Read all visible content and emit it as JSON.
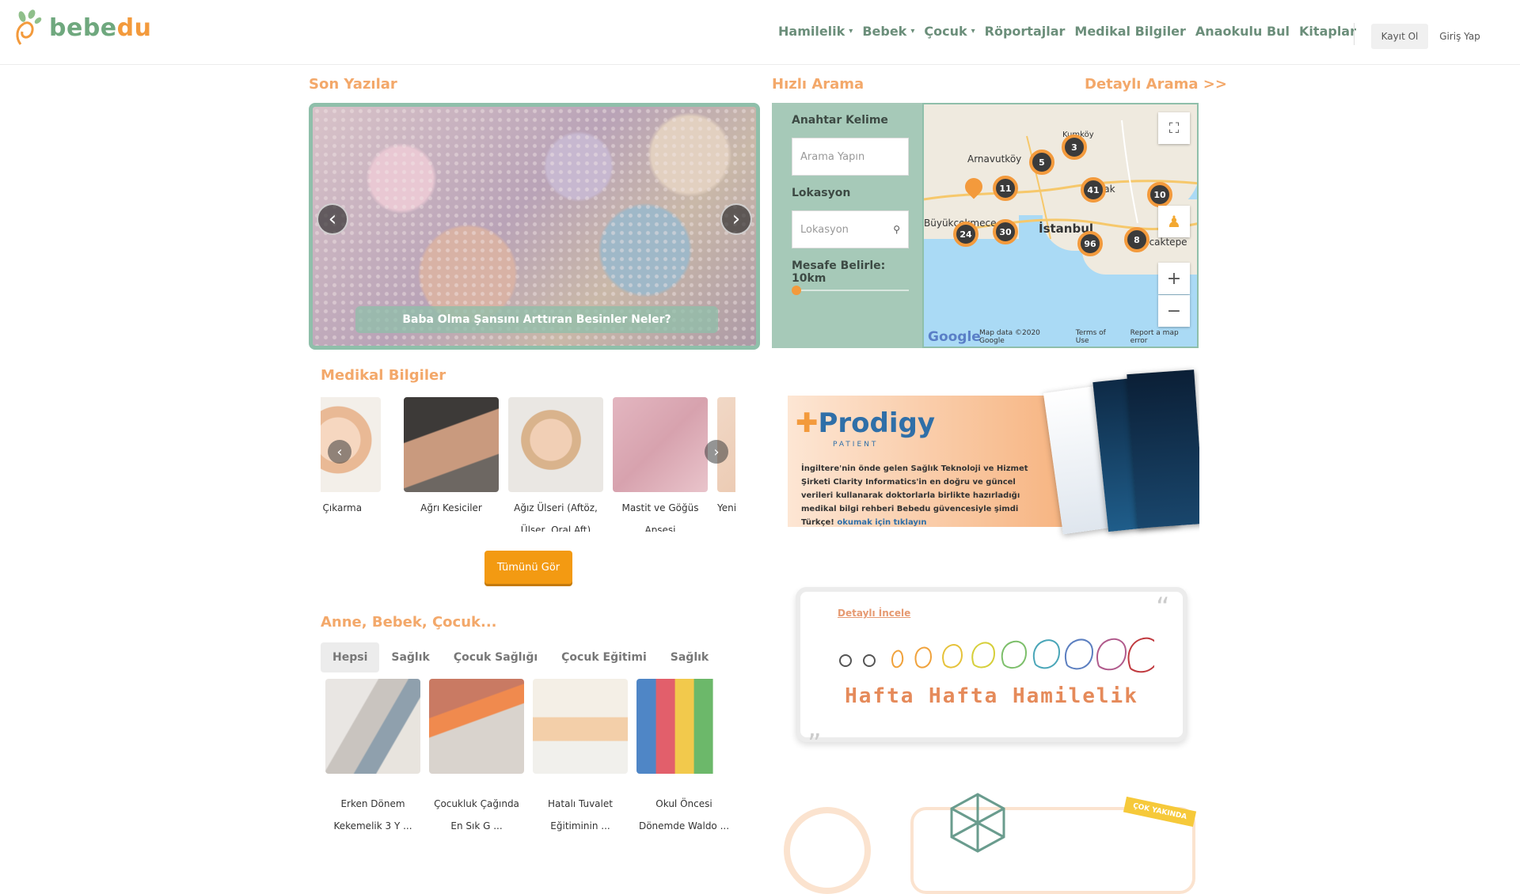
{
  "header": {
    "logo_text_a": "bebe",
    "logo_text_b": "du",
    "nav": [
      "Hamilelik",
      "Bebek",
      "Çocuk",
      "Röportajlar",
      "Medikal Bilgiler",
      "Anaokulu Bul",
      "Kitaplar"
    ],
    "register": "Kayıt Ol",
    "login": "Giriş Yap"
  },
  "latest": {
    "title": "Son Yazılar",
    "caption": "Baba Olma Şansını Arttıran Besinler Neler?"
  },
  "quick_search": {
    "title": "Hızlı Arama",
    "detailed_link": "Detaylı Arama >>",
    "keyword_label": "Anahtar Kelime",
    "keyword_placeholder": "Arama Yapın",
    "location_label": "Lokasyon",
    "location_placeholder": "Lokasyon",
    "distance_label": "Mesafe Belirle: 10km"
  },
  "map": {
    "places": [
      "Kumköy",
      "Arnavutköy",
      "Maslak",
      "Büyükçekmece",
      "İstanbul",
      "Sancaktepe"
    ],
    "clusters": [
      "3",
      "5",
      "11",
      "41",
      "10",
      "24",
      "30",
      "96",
      "8"
    ],
    "google": "Google",
    "map_data": "Map data ©2020 Google",
    "terms": "Terms of Use",
    "report": "Report a map error"
  },
  "medical": {
    "title": "Medikal Bilgiler",
    "items": [
      "Diş Çıkarma",
      "Ağrı Kesiciler",
      "Ağız Ülseri (Aftöz, Ülser, Oral Aft)",
      "Mastit ve Göğüs Apsesi",
      "Yeni"
    ],
    "all_button": "Tümünü Gör"
  },
  "articles": {
    "title": "Anne, Bebek, Çocuk...",
    "tabs": [
      "Hepsi",
      "Sağlık",
      "Çocuk Sağlığı",
      "Çocuk Eğitimi",
      "Sağlık"
    ],
    "items": [
      "Erken Dönem Kekemelik 3 Y ...",
      "Çocukluk Çağında En Sık G ...",
      "Hatalı Tuvalet Eğitiminin ...",
      "Okul Öncesi Dönemde Waldo ..."
    ]
  },
  "ads": {
    "prodigy_name": "Prodigy",
    "prodigy_sub": "PATIENT",
    "prodigy_text": "İngiltere'nin önde gelen Sağlık Teknoloji ve Hizmet Şirketi Clarity Informatics'in en doğru ve güncel verileri kullanarak doktorlarla birlikte hazırladığı medikal bilgi rehberi Bebedu güvencesiyle şimdi Türkçe!",
    "prodigy_link": "okumak için tıklayın",
    "hamilelik_link": "Detaylı İncele",
    "hamilelik_title": "Hafta Hafta Hamilelik",
    "coming_soon": "ÇOK YAKINDA"
  },
  "colors": {
    "accent_orange": "#f39a3c",
    "accent_green": "#8fbfaa",
    "nav_green": "#6b8e7a"
  }
}
